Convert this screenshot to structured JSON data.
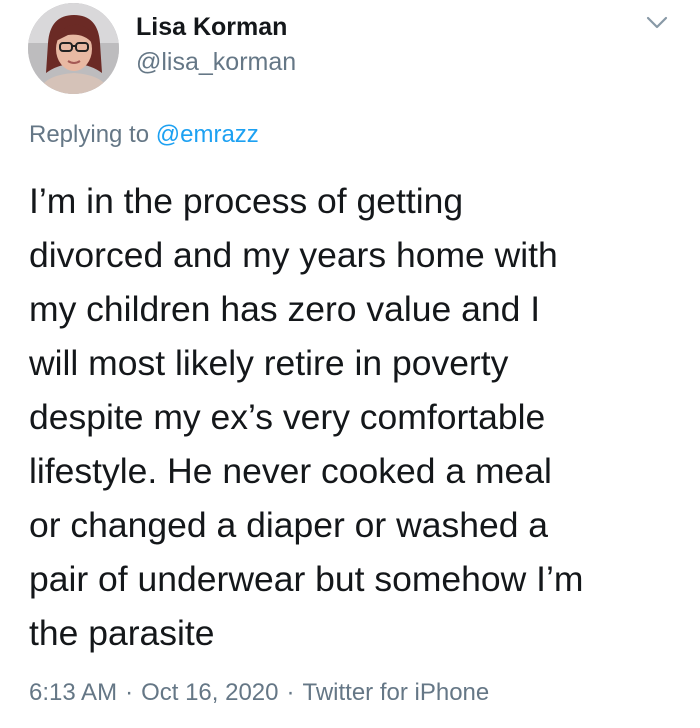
{
  "author": {
    "display_name": "Lisa Korman",
    "handle": "@lisa_korman"
  },
  "icons": {
    "avatar": "profile-photo",
    "menu": "chevron-down-icon"
  },
  "reply": {
    "prefix": "Replying to ",
    "target": "@emrazz"
  },
  "tweet": {
    "text": "I’m in the process of getting\ndivorced and my years home with\nmy children has zero value and I\nwill most likely retire in poverty\ndespite my ex’s very comfortable\nlifestyle. He never cooked a meal\nor changed a diaper or washed a\npair of underwear but somehow I’m\nthe parasite"
  },
  "meta": {
    "time": "6:13 AM",
    "date": "Oct 16, 2020",
    "source": "Twitter for iPhone",
    "separator": "·"
  },
  "colors": {
    "text": "#14171a",
    "secondary": "#657786",
    "link": "#1da1f2",
    "background": "#ffffff"
  }
}
